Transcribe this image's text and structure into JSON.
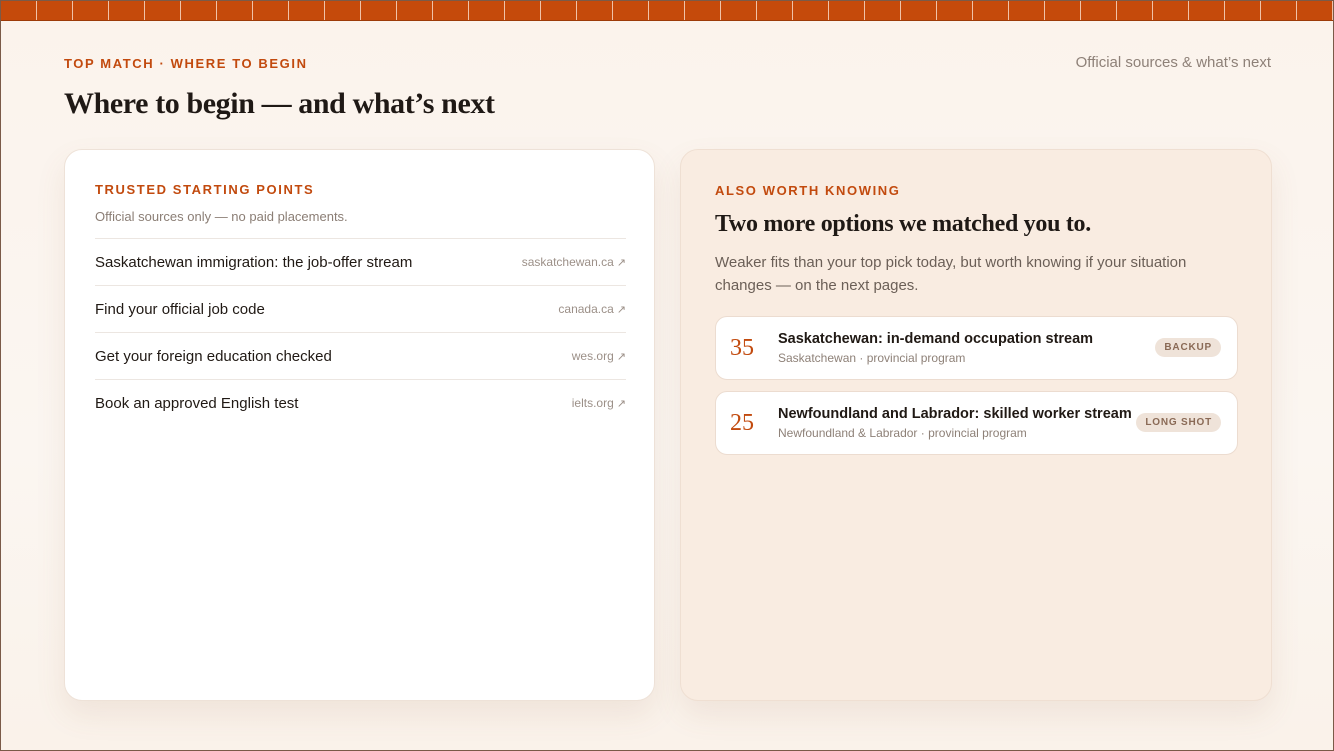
{
  "header": {
    "eyebrow": "TOP MATCH · WHERE TO BEGIN",
    "title": "Where to begin — and what’s next",
    "top_right": "Official sources & what’s next"
  },
  "left_card": {
    "eyebrow": "TRUSTED STARTING POINTS",
    "subtitle": "Official sources only — no paid placements.",
    "links": [
      {
        "title": "Saskatchewan immigration: the job-offer stream",
        "domain": "saskatchewan.ca",
        "icon": "external-link-icon"
      },
      {
        "title": "Find your official job code",
        "domain": "canada.ca",
        "icon": "external-link-icon"
      },
      {
        "title": "Get your foreign education checked",
        "domain": "wes.org",
        "icon": "external-link-icon"
      },
      {
        "title": "Book an approved English test",
        "domain": "ielts.org",
        "icon": "external-link-icon"
      }
    ]
  },
  "right_card": {
    "eyebrow": "ALSO WORTH KNOWING",
    "heading": "Two more options we matched you to.",
    "description": "Weaker fits than your top pick today, but worth knowing if your situation changes — on the next pages.",
    "options": [
      {
        "score": "35",
        "title": "Saskatchewan: in-demand occupation stream",
        "subtitle": "Saskatchewan · provincial program",
        "badge": "BACKUP"
      },
      {
        "score": "25",
        "title": "Newfoundland and Labrador: skilled worker stream",
        "subtitle": "Newfoundland & Labrador · provincial program",
        "badge": "LONG SHOT"
      }
    ]
  },
  "colors": {
    "accent": "#c24a0e",
    "background": "#fbf4ee",
    "right_card_bg": "#f9ece1",
    "badge_bg": "#efe3d9"
  }
}
